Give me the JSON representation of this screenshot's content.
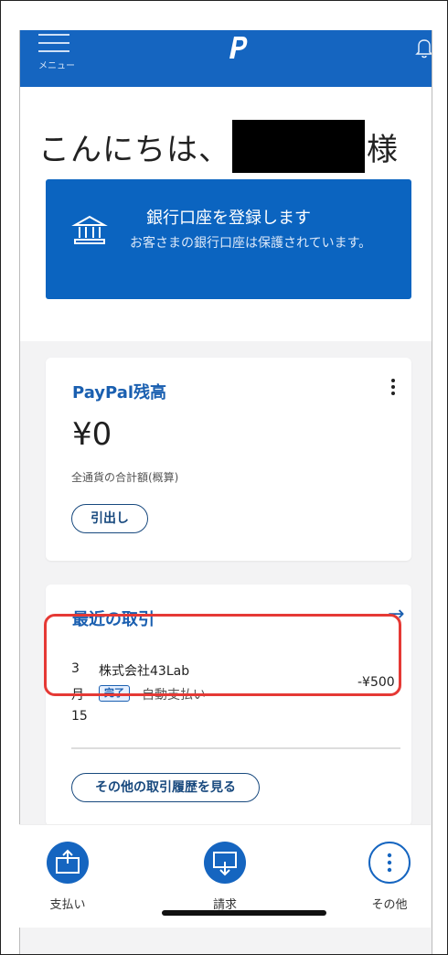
{
  "header": {
    "menu_label": "メニュー",
    "icons": {
      "menu": "hamburger-menu-icon",
      "logo": "paypal-logo",
      "notifications": "bell-icon"
    }
  },
  "greeting": {
    "prefix": "こんにちは、",
    "suffix": "様"
  },
  "bank_banner": {
    "title": "銀行口座を登録します",
    "subtitle": "お客さまの銀行口座は保護されています。",
    "icon": "bank-icon"
  },
  "balance_card": {
    "title": "PayPal残高",
    "amount": "¥0",
    "note": "全通貨の合計額(概算)",
    "withdraw_label": "引出し",
    "menu_icon": "more-vertical-icon"
  },
  "transactions_card": {
    "title": "最近の取引",
    "arrow_icon": "arrow-right-icon",
    "items": [
      {
        "date_line1": "3",
        "date_line2": "月",
        "date_line3": "15",
        "merchant": "株式会社43Lab",
        "status": "完了",
        "type": "自動支払い",
        "amount": "-¥500"
      }
    ],
    "history_label": "その他の取引履歴を見る"
  },
  "bottom_nav": [
    {
      "label": "支払い",
      "icon": "send-money-icon"
    },
    {
      "label": "請求",
      "icon": "request-money-icon"
    },
    {
      "label": "その他",
      "icon": "more-icon"
    }
  ],
  "colors": {
    "brand_blue": "#1565c0",
    "banner_blue": "#0b64c0",
    "link_blue": "#1a5fb0",
    "highlight_red": "#e53935"
  }
}
